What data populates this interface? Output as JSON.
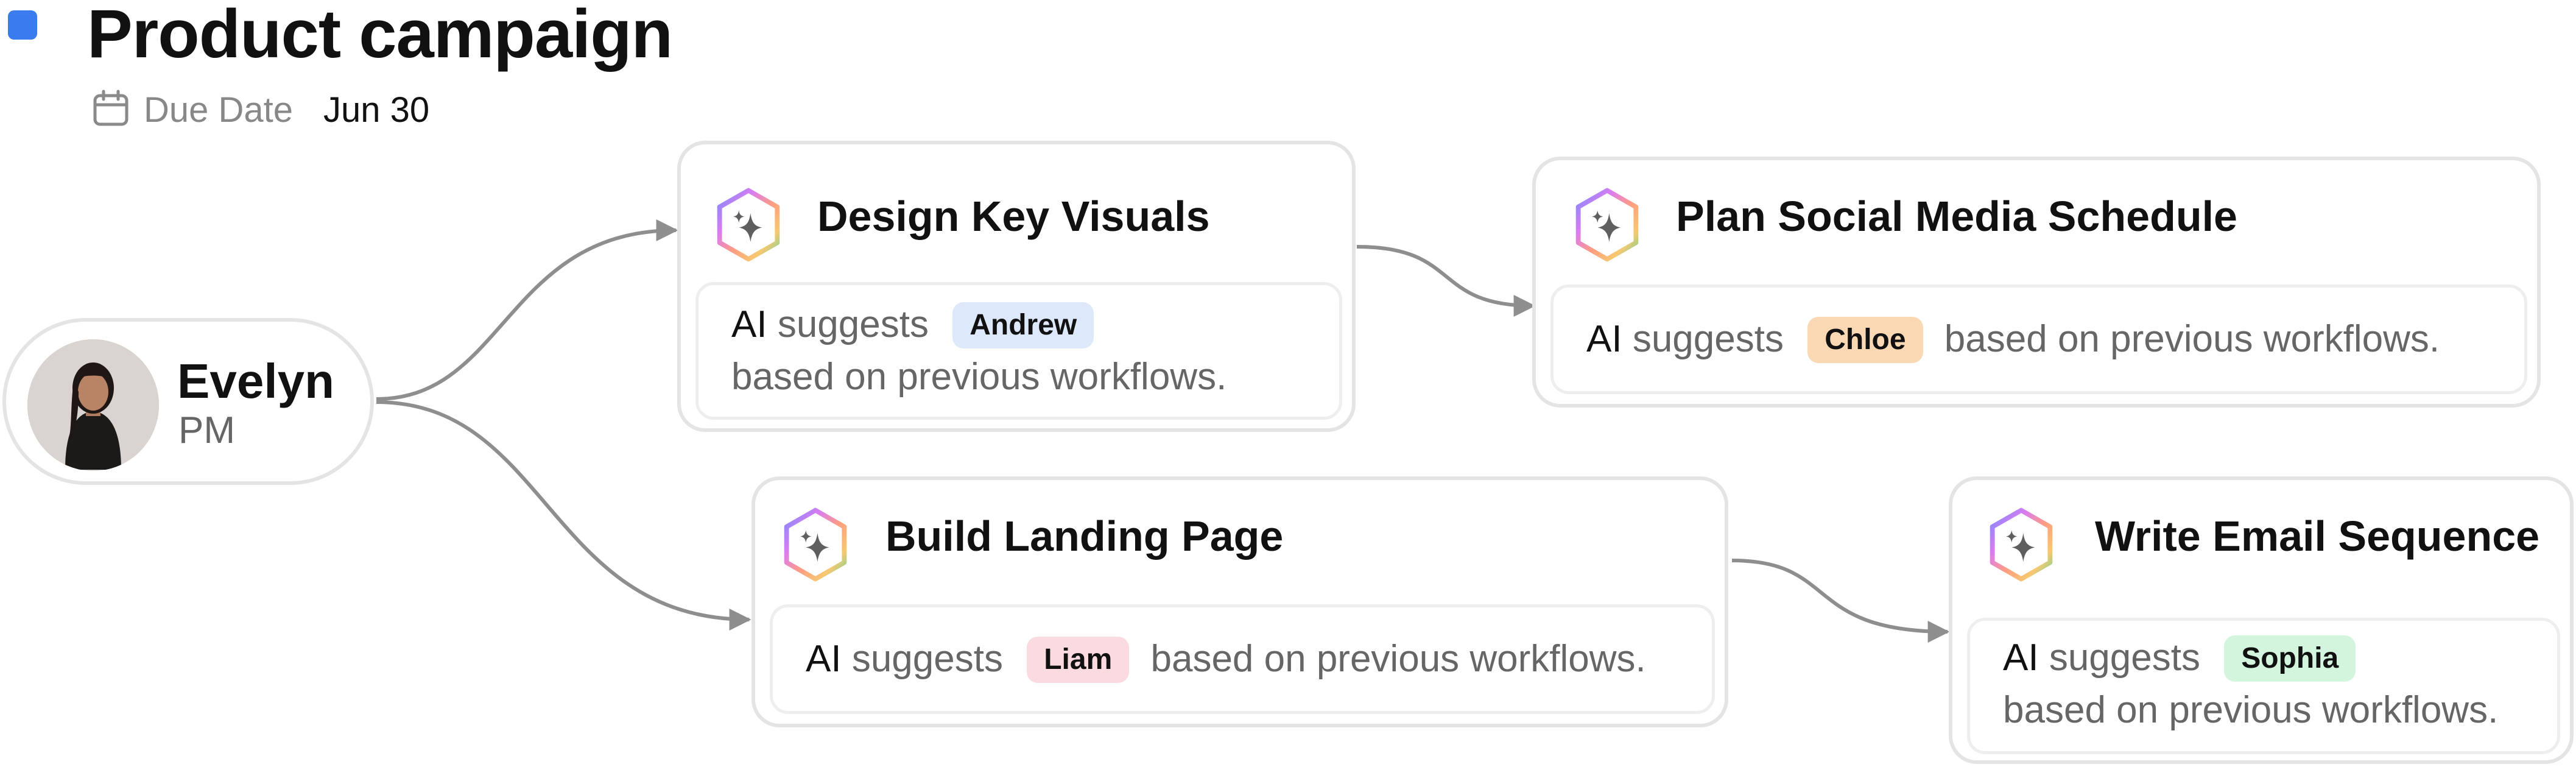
{
  "project": {
    "title": "Product campaign",
    "accent_color": "#3b7bf0",
    "due": {
      "icon": "calendar-icon",
      "label": "Due Date",
      "value": "Jun 30"
    }
  },
  "owner": {
    "name": "Evelyn",
    "role": "PM"
  },
  "tasks": [
    {
      "title": "Design Key Visuals",
      "icon": "ai-sparkle-icon",
      "ai_label": "AI",
      "suggests_text": "suggests",
      "assignee": "Andrew",
      "assignee_color": "#dde8fb",
      "suffix": "based on previous workflows."
    },
    {
      "title": "Plan Social Media Schedule",
      "icon": "ai-sparkle-icon",
      "ai_label": "AI",
      "suggests_text": "suggests",
      "assignee": "Chloe",
      "assignee_color": "#fbd8b4",
      "suffix": "based on previous workflows."
    },
    {
      "title": "Build Landing Page",
      "icon": "ai-sparkle-icon",
      "ai_label": "AI",
      "suggests_text": "suggests",
      "assignee": "Liam",
      "assignee_color": "#fbdbdf",
      "suffix": "based on previous workflows."
    },
    {
      "title": "Write Email Sequence",
      "icon": "ai-sparkle-icon",
      "ai_label": "AI",
      "suggests_text": "suggests",
      "assignee": "Sophia",
      "assignee_color": "#d3f5de",
      "suffix": "based on previous workflows."
    }
  ]
}
